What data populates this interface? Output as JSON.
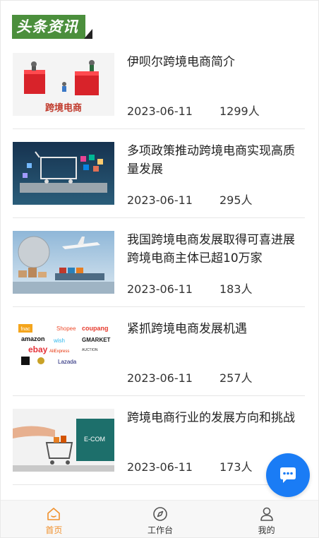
{
  "header": {
    "title": "头条资讯"
  },
  "news": [
    {
      "title": "伊呗尔跨境电商简介",
      "date": "2023-06-11",
      "views": "1299人",
      "thumb_text": "跨境电商"
    },
    {
      "title": "多项政策推动跨境电商实现高质量发展",
      "date": "2023-06-11",
      "views": "295人"
    },
    {
      "title": "我国跨境电商发展取得可喜进展 跨境电商主体已超10万家",
      "date": "2023-06-11",
      "views": "183人"
    },
    {
      "title": "紧抓跨境电商发展机遇",
      "date": "2023-06-11",
      "views": "257人",
      "logos": [
        "fnac",
        "amazon",
        "Shopee",
        "coupang",
        "wish",
        "GMARKET",
        "ebay",
        "AliExpress",
        "AUCTION",
        "Lazada"
      ]
    },
    {
      "title": "跨境电商行业的发展方向和挑战",
      "date": "2023-06-11",
      "views": "173人",
      "thumb_text": "E-COM"
    }
  ],
  "tabbar": {
    "items": [
      {
        "label": "首页",
        "icon": "home-icon",
        "active": true
      },
      {
        "label": "工作台",
        "icon": "compass-icon",
        "active": false
      },
      {
        "label": "我的",
        "icon": "user-icon",
        "active": false
      }
    ]
  },
  "fab": {
    "icon": "chat-bubble-icon"
  },
  "colors": {
    "accent": "#f0902c",
    "fab": "#1a7cf5",
    "header_badge": "#4b8f3c"
  }
}
